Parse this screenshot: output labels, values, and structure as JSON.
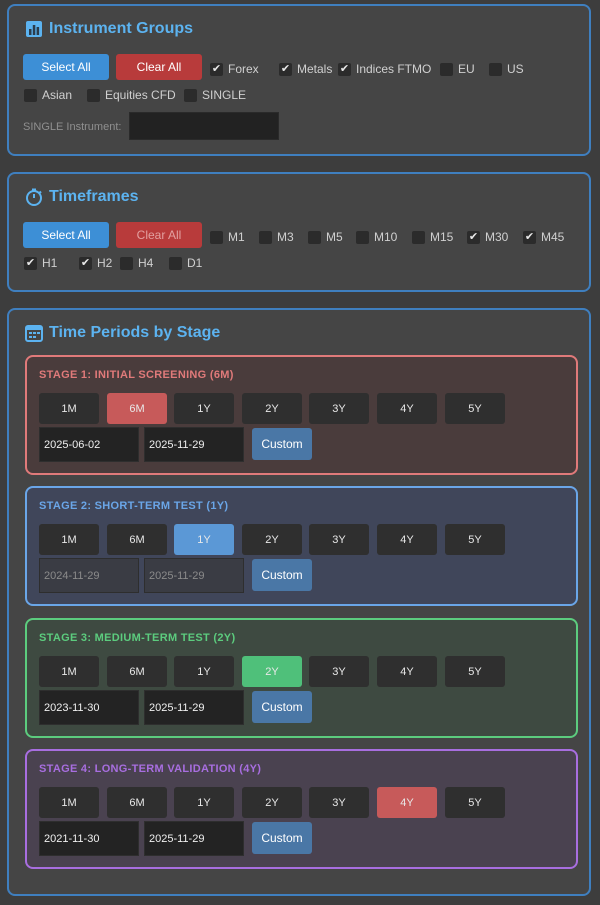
{
  "instrument_groups": {
    "title": "Instrument Groups",
    "select_all": "Select All",
    "clear_all": "Clear All",
    "checkboxes": [
      {
        "label": "Forex",
        "checked": true
      },
      {
        "label": "Metals",
        "checked": true
      },
      {
        "label": "Indices FTMO",
        "checked": true
      },
      {
        "label": "EU",
        "checked": false
      },
      {
        "label": "US",
        "checked": false
      },
      {
        "label": "Asian",
        "checked": false
      },
      {
        "label": "Equities CFD",
        "checked": false
      },
      {
        "label": "SINGLE",
        "checked": false
      }
    ],
    "single_label": "SINGLE Instrument:",
    "single_value": ""
  },
  "timeframes": {
    "title": "Timeframes",
    "select_all": "Select All",
    "clear_all": "Clear All",
    "checkboxes": [
      {
        "label": "M1",
        "checked": false
      },
      {
        "label": "M3",
        "checked": false
      },
      {
        "label": "M5",
        "checked": false
      },
      {
        "label": "M10",
        "checked": false
      },
      {
        "label": "M15",
        "checked": false
      },
      {
        "label": "M30",
        "checked": true
      },
      {
        "label": "M45",
        "checked": true
      },
      {
        "label": "H1",
        "checked": true
      },
      {
        "label": "H2",
        "checked": true
      },
      {
        "label": "H4",
        "checked": false
      },
      {
        "label": "D1",
        "checked": false
      }
    ]
  },
  "periods": {
    "title": "Time Periods by Stage",
    "period_labels": [
      "1M",
      "6M",
      "1Y",
      "2Y",
      "3Y",
      "4Y",
      "5Y"
    ],
    "custom_label": "Custom",
    "stages": [
      {
        "title": "STAGE 1: INITIAL SCREENING (6M)",
        "selected": "6M",
        "start": "2025-06-02",
        "end": "2025-11-29",
        "dates_disabled": false,
        "accent": "#e07a7a",
        "bg": "#4a3c3c",
        "sel_bg": "#c75a5a"
      },
      {
        "title": "STAGE 2: SHORT-TERM TEST (1Y)",
        "selected": "1Y",
        "start": "2024-11-29",
        "end": "2025-11-29",
        "dates_disabled": true,
        "accent": "#6aa6e8",
        "bg": "#40465a",
        "sel_bg": "#5b98d6"
      },
      {
        "title": "STAGE 3: MEDIUM-TERM TEST (2Y)",
        "selected": "2Y",
        "start": "2023-11-30",
        "end": "2025-11-29",
        "dates_disabled": false,
        "accent": "#5ccc7e",
        "bg": "#3e4a41",
        "sel_bg": "#4fc07a"
      },
      {
        "title": "STAGE 4: LONG-TERM VALIDATION (4Y)",
        "selected": "4Y",
        "start": "2021-11-30",
        "end": "2025-11-29",
        "dates_disabled": false,
        "accent": "#a86ee0",
        "bg": "#4a4250",
        "sel_bg": "#c75a5a"
      }
    ]
  },
  "colors": {
    "accent_title": "#5cb3f0",
    "panel_border": "#3f7fbf",
    "blue_button": "#3d8fd6",
    "red_button": "#b83b3b",
    "custom_button": "#4a77a6"
  },
  "icons": {
    "instrument_groups": "bar-chart-icon",
    "timeframes": "stopwatch-icon",
    "periods": "calendar-icon"
  }
}
